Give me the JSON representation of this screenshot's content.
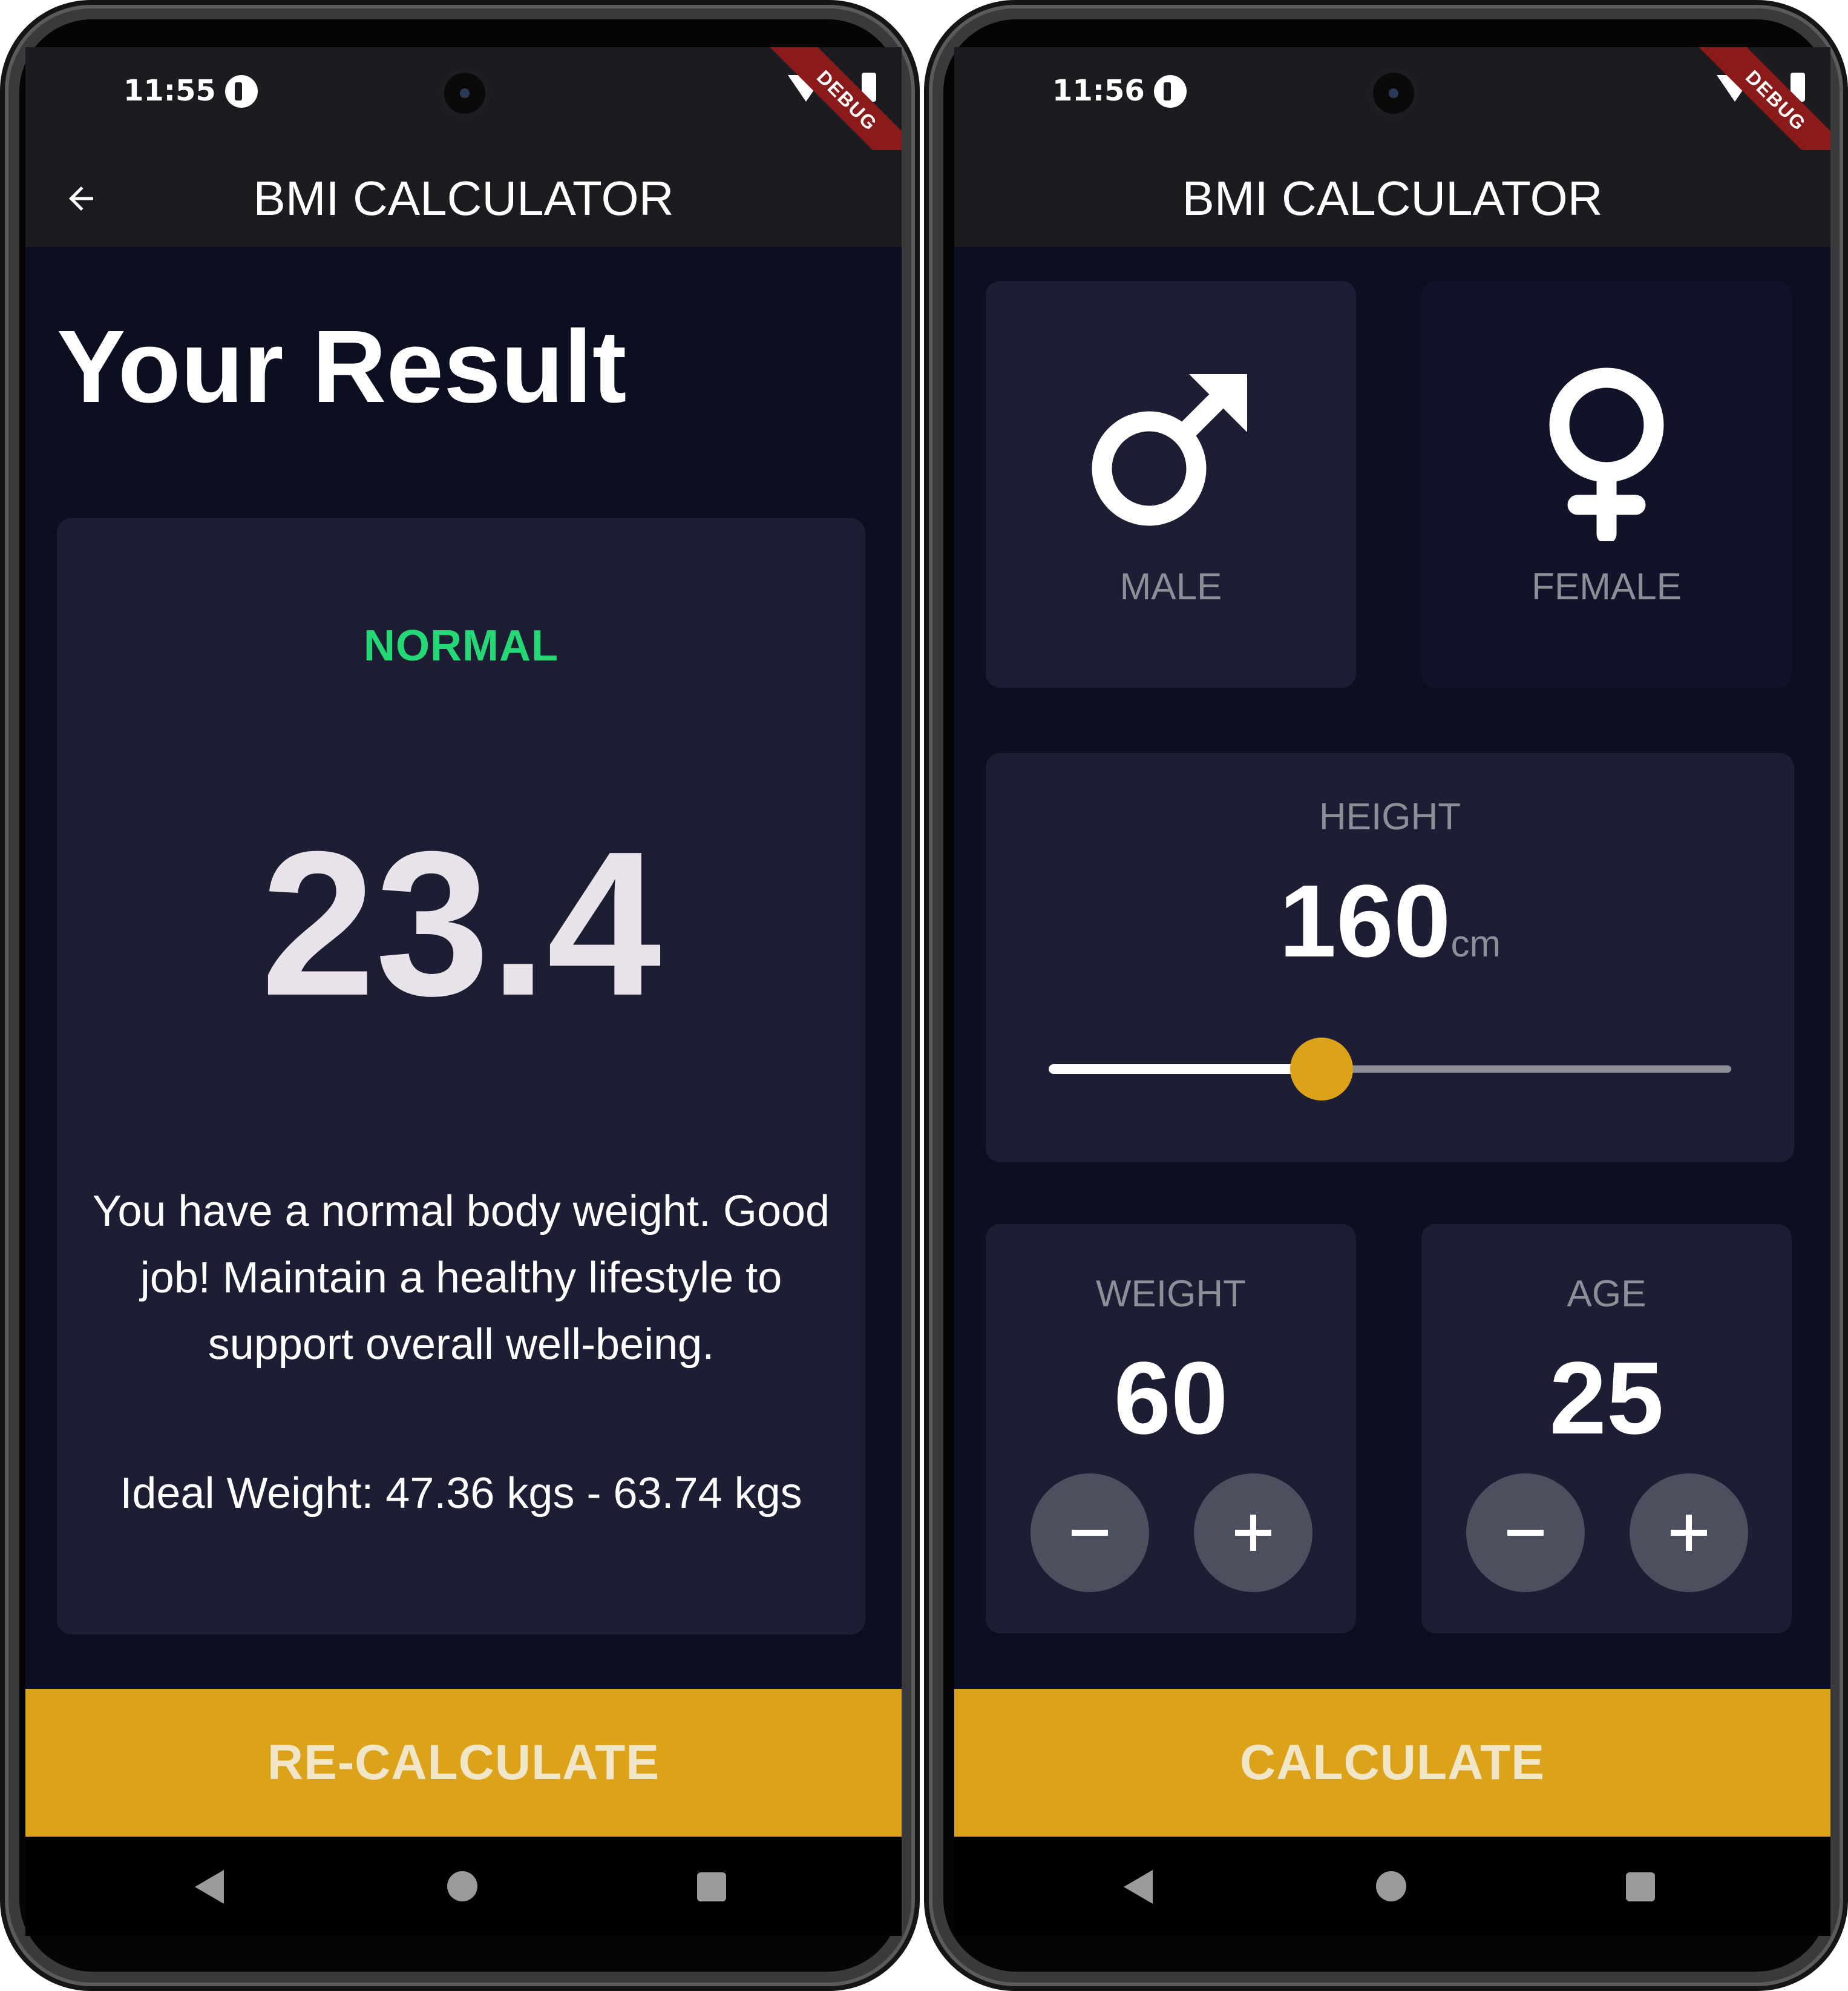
{
  "left": {
    "status": {
      "time": "11:55",
      "debug_label": "DEBUG"
    },
    "appbar": {
      "title": "BMI CALCULATOR"
    },
    "heading": "Your Result",
    "result": {
      "status": "NORMAL",
      "status_color": "#24d876",
      "bmi": "23.4",
      "interpretation": "You have a normal body weight. Good job! Maintain a healthy lifestyle to support overall well-being.",
      "ideal_weight": "Ideal Weight: 47.36 kgs - 63.74 kgs"
    },
    "button": {
      "label": "RE-CALCULATE"
    }
  },
  "right": {
    "status": {
      "time": "11:56",
      "debug_label": "DEBUG"
    },
    "appbar": {
      "title": "BMI CALCULATOR"
    },
    "gender": {
      "male_label": "MALE",
      "female_label": "FEMALE",
      "selected": "male"
    },
    "height": {
      "label": "HEIGHT",
      "value": "160",
      "unit": "cm",
      "slider_fraction": 0.4
    },
    "weight": {
      "label": "WEIGHT",
      "value": "60"
    },
    "age": {
      "label": "AGE",
      "value": "25"
    },
    "button": {
      "label": "CALCULATE"
    }
  },
  "colors": {
    "background": "#0b0f20",
    "card_active": "#1d1e33",
    "card_inactive": "#111328",
    "accent": "#dca31a",
    "normal_status": "#24d876"
  },
  "icons": [
    "back-arrow-icon",
    "male-icon",
    "female-icon",
    "minus-icon",
    "plus-icon",
    "wifi-icon",
    "battery-icon",
    "nav-back-icon",
    "nav-home-icon",
    "nav-recents-icon"
  ]
}
